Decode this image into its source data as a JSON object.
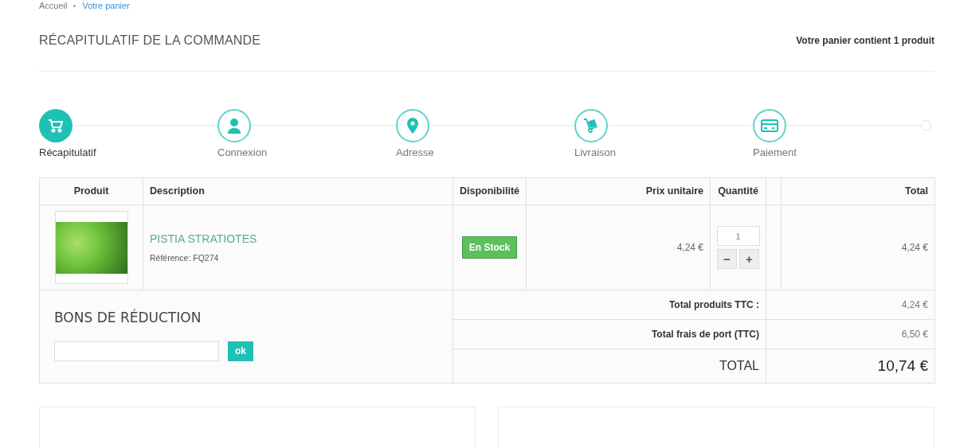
{
  "breadcrumb": [
    {
      "label": "Accueil",
      "current": false
    },
    {
      "label": "Votre panier",
      "current": true
    }
  ],
  "page_title": "RÉCAPITULATIF DE LA COMMANDE",
  "cart_count": "Votre panier contient 1 produit",
  "steps": [
    {
      "label": "Récapitulatif",
      "kind": "cart",
      "selected": true
    },
    {
      "label": "Connexion",
      "kind": "user",
      "selected": false
    },
    {
      "label": "Adresse",
      "kind": "pin",
      "selected": false
    },
    {
      "label": "Livraison",
      "kind": "trolley",
      "selected": false
    },
    {
      "label": "Paiement",
      "kind": "card",
      "selected": false
    }
  ],
  "table": {
    "columns": [
      "Produit",
      "Description",
      "Disponibilité",
      "Prix unitaire",
      "Quantité",
      "",
      "Total"
    ],
    "rows": [
      {
        "name": "PISTIA STRATIOTES",
        "reference": "Référence: FQ274",
        "availability": "En Stock",
        "unit_price": "4,24 €",
        "quantity": "1",
        "minus": "−",
        "plus": "+",
        "total": "4,24 €"
      }
    ]
  },
  "voucher": {
    "title": "BONS DE RÉDUCTION",
    "button": "ok"
  },
  "totals": [
    {
      "label": "Total produits TTC :",
      "value": "4,24 €",
      "kind": "line"
    },
    {
      "label": "Total frais de port (TTC)",
      "value": "6,50 €",
      "kind": "line"
    },
    {
      "label": "TOTAL",
      "value": "10,74 €",
      "kind": "grand"
    }
  ]
}
